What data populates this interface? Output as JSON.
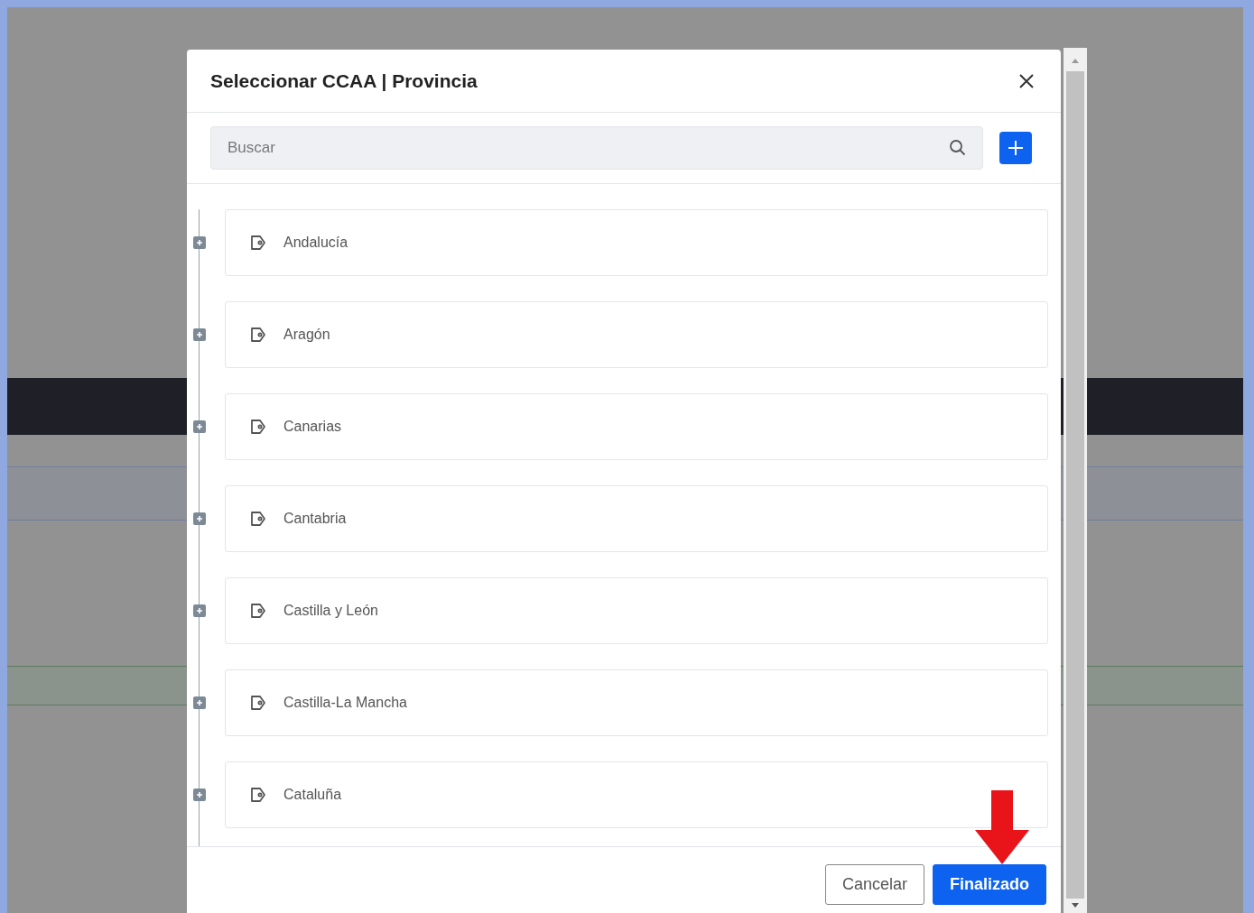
{
  "dialog": {
    "title": "Seleccionar CCAA | Provincia",
    "search": {
      "placeholder": "Buscar"
    },
    "items": [
      {
        "label": "Andalucía",
        "expanded": false
      },
      {
        "label": "Aragón",
        "expanded": false
      },
      {
        "label": "Canarias",
        "expanded": false
      },
      {
        "label": "Cantabria",
        "expanded": false
      },
      {
        "label": "Castilla y León",
        "expanded": false
      },
      {
        "label": "Castilla-La Mancha",
        "expanded": false
      },
      {
        "label": "Cataluña",
        "expanded": false
      }
    ],
    "buttons": [
      {
        "label": "Cancelar",
        "kind": "secondary"
      },
      {
        "label": "Finalizado",
        "kind": "primary"
      }
    ]
  }
}
